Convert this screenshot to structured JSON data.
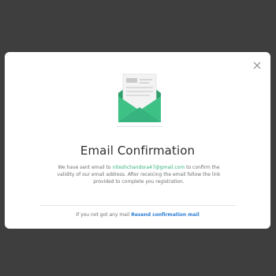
{
  "modal": {
    "title": "Email Confirmation",
    "message_prefix": "We have sent email to",
    "email": "niteshchandora47@gmail.com",
    "message_suffix": "to confirm the validity  of our email address. After receicing the email follow the link provided to complete you registration.",
    "footer_text": "If you not got any mail",
    "resend_label": "Resend confirmation mail",
    "close_icon": "close-icon",
    "illustration_icon": "email-envelope-icon"
  },
  "colors": {
    "backdrop": "#3e3e3e",
    "accent_green": "#36b37e",
    "link_blue": "#2d7fd6"
  }
}
